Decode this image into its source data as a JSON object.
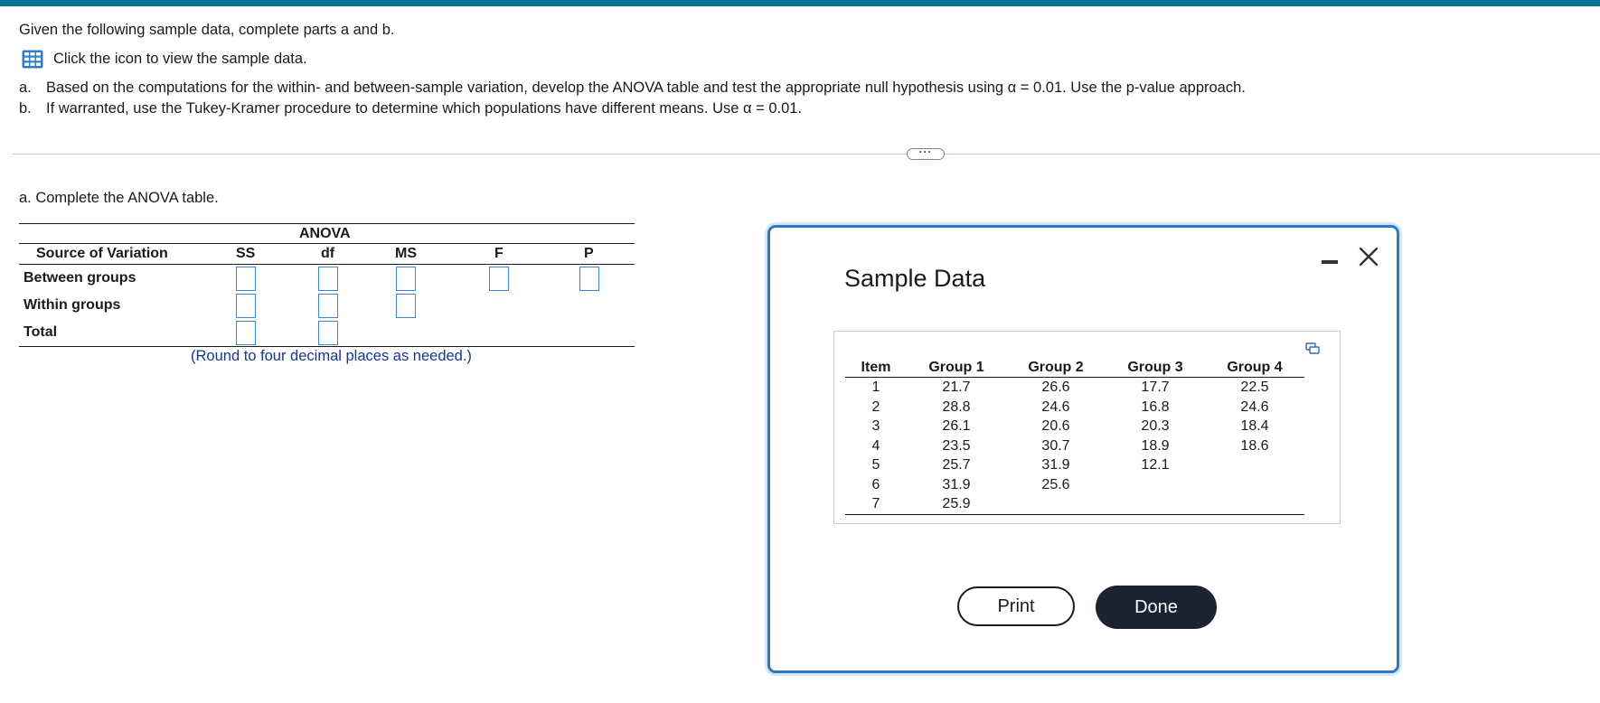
{
  "problem": {
    "intro": "Given the following sample data, complete parts a and b.",
    "data_link": "Click the icon to view the sample data.",
    "part_a_marker": "a.",
    "part_a": "Based on the computations for the within- and between-sample variation, develop the ANOVA table and test the appropriate null hypothesis using α = 0.01. Use the p-value approach.",
    "part_b_marker": "b.",
    "part_b": "If warranted, use the Tukey-Kramer procedure to determine which populations have different means. Use α = 0.01."
  },
  "more_button": "···",
  "anova": {
    "prompt": "a. Complete the ANOVA table.",
    "title": "ANOVA",
    "headers": {
      "source": "Source of Variation",
      "ss": "SS",
      "df": "df",
      "ms": "MS",
      "f": "F",
      "p": "P"
    },
    "rows": {
      "between": "Between groups",
      "within": "Within groups",
      "total": "Total"
    },
    "note": "(Round to four decimal places as needed.)"
  },
  "dialog": {
    "title": "Sample Data",
    "table": {
      "headers": [
        "Item",
        "Group 1",
        "Group 2",
        "Group 3",
        "Group 4"
      ],
      "rows": [
        [
          "1",
          "21.7",
          "26.6",
          "17.7",
          "22.5"
        ],
        [
          "2",
          "28.8",
          "24.6",
          "16.8",
          "24.6"
        ],
        [
          "3",
          "26.1",
          "20.6",
          "20.3",
          "18.4"
        ],
        [
          "4",
          "23.5",
          "30.7",
          "18.9",
          "18.6"
        ],
        [
          "5",
          "25.7",
          "31.9",
          "12.1",
          ""
        ],
        [
          "6",
          "31.9",
          "25.6",
          "",
          ""
        ],
        [
          "7",
          "25.9",
          "",
          "",
          ""
        ]
      ]
    },
    "print_label": "Print",
    "done_label": "Done"
  },
  "colors": {
    "top_bar": "#0b7596",
    "input_border": "#3d85d6",
    "note_text": "#15359a",
    "dialog_border": "#2d78c4",
    "done_button": "#1b2430"
  }
}
